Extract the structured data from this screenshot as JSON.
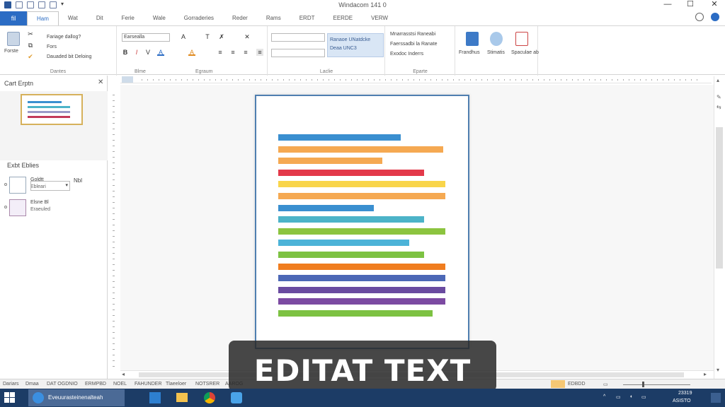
{
  "window": {
    "title": "Windacom 141 0",
    "minimize_glyph": "—",
    "maximize_glyph": "☐",
    "close_glyph": "✕"
  },
  "ribbon_tabs": {
    "file": "fil",
    "items": [
      "Ham",
      "Wat",
      "Dit",
      "Ferie",
      "Wale",
      "Gorraderies",
      "Reder",
      "Rams",
      "ERDT",
      "EERDE",
      "VERW"
    ],
    "active_index": 0
  },
  "ribbon": {
    "clipboard": {
      "paste_label": "Forste",
      "cmd1": "Fariage dallog?",
      "cmd2": "Fors",
      "cmd3": "Dauaded bit Deloing",
      "group_label": "Dantes"
    },
    "font": {
      "font_name": "Earsealla",
      "group_label": "Blme",
      "format_glyphs": [
        "B",
        "I",
        "V",
        "A",
        "A"
      ]
    },
    "paragraph": {
      "group_label": "Egraum"
    },
    "styles": {
      "gallery_line1": "Ranaoe UNatdcke",
      "gallery_line2": "Deaa UNC3",
      "group_label": "Laclie"
    },
    "editing": {
      "line1": "Mnarrasstsi Raneabi",
      "line2": "Faerssadbi la Ranate",
      "line3": "Exodoc Inderrs",
      "group_label": "Eparte"
    },
    "big_buttons": [
      {
        "label": "Frandhus",
        "icon": "shapes-icon"
      },
      {
        "label": "Stimatis",
        "icon": "people-icon"
      },
      {
        "label": "Spaculae ab",
        "icon": "edit-doc-icon"
      }
    ]
  },
  "nav_pane": {
    "title": "Cart Erptn",
    "close_glyph": "✕",
    "section_title": "Exbt Eblies",
    "items": [
      {
        "line1": "Goldtt",
        "line2": "Ebleari",
        "suffix": "Nbl"
      },
      {
        "line1": "Elsne Bl",
        "line2": "Eraeuled"
      }
    ]
  },
  "document": {
    "lines": [
      {
        "color": "#3a8fd0",
        "length": 0.58
      },
      {
        "color": "#f5a952",
        "length": 0.78
      },
      {
        "color": "#f5a952",
        "length": 0.49
      },
      {
        "color": "#e3394a",
        "length": 0.69
      },
      {
        "color": "#f9d54a",
        "length": 0.79
      },
      {
        "color": "#f5a952",
        "length": 0.79
      },
      {
        "color": "#3a8fd0",
        "length": 0.45
      },
      {
        "color": "#4cb3c8",
        "length": 0.69
      },
      {
        "color": "#8cc43f",
        "length": 0.79
      },
      {
        "color": "#4cb3d8",
        "length": 0.62
      },
      {
        "color": "#7dc242",
        "length": 0.69
      },
      {
        "color": "#f07d1f",
        "length": 0.79
      },
      {
        "color": "#4c68b6",
        "length": 0.79
      },
      {
        "color": "#6a4ba0",
        "length": 0.79
      },
      {
        "color": "#7c4aa2",
        "length": 0.79
      },
      {
        "color": "#7dc242",
        "length": 0.73
      }
    ]
  },
  "status_bar": {
    "left": [
      "Dariars",
      "Dmaa",
      "DAT OGDNIO",
      "ERMPBD",
      "NOEL",
      "FAHUNDER",
      "Tlaeeloer",
      "NOTSRER",
      "AAROG"
    ],
    "view_mode": "EDBDD"
  },
  "overlay": {
    "caption": "EDITAT TEXT"
  },
  "taskbar": {
    "active_app_label": "Eveuurasteinenalteah",
    "time": "23319",
    "date": "ASISTO"
  },
  "colors": {
    "accent": "#2b6cc4",
    "taskbar": "#1c3c66",
    "page_border": "#4f7fb0"
  }
}
